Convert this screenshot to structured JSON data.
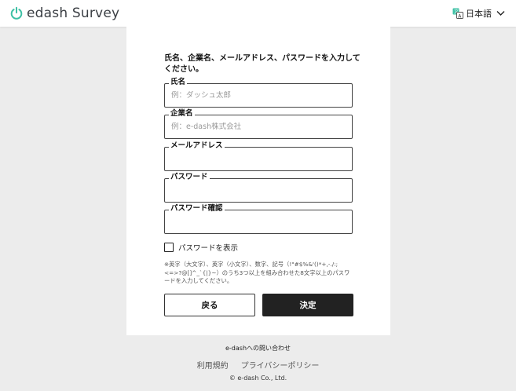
{
  "header": {
    "logo_text": "edash Survey",
    "language_label": "日本語"
  },
  "form": {
    "instruction": "氏名、企業名、メールアドレス、パスワードを入力してください。",
    "fields": [
      {
        "label": "氏名",
        "placeholder": "例：ダッシュ太郎",
        "value": ""
      },
      {
        "label": "企業名",
        "placeholder": "例：e-dash株式会社",
        "value": ""
      },
      {
        "label": "メールアドレス",
        "placeholder": "",
        "value": ""
      },
      {
        "label": "パスワード",
        "placeholder": "",
        "value": ""
      },
      {
        "label": "パスワード確認",
        "placeholder": "",
        "value": ""
      }
    ],
    "show_password_label": "パスワードを表示",
    "show_password_checked": false,
    "hint": "※英字（大文字）、英字（小文字）、数字、記号（!\"#$%&'()*+,-./:;<=>?@[]^_`{|}~）のうち3つ以上を組み合わせた8文字以上のパスワードを入力してください。",
    "back_label": "戻る",
    "submit_label": "決定"
  },
  "footer": {
    "contact": "e-dashへの問い合わせ",
    "terms": "利用規約",
    "privacy": "プライバシーポリシー",
    "copyright": "© e-dash Co., Ltd."
  },
  "colors": {
    "brand_teal": "#3cc0a4",
    "primary_button": "#222222",
    "page_background": "#ececec"
  }
}
